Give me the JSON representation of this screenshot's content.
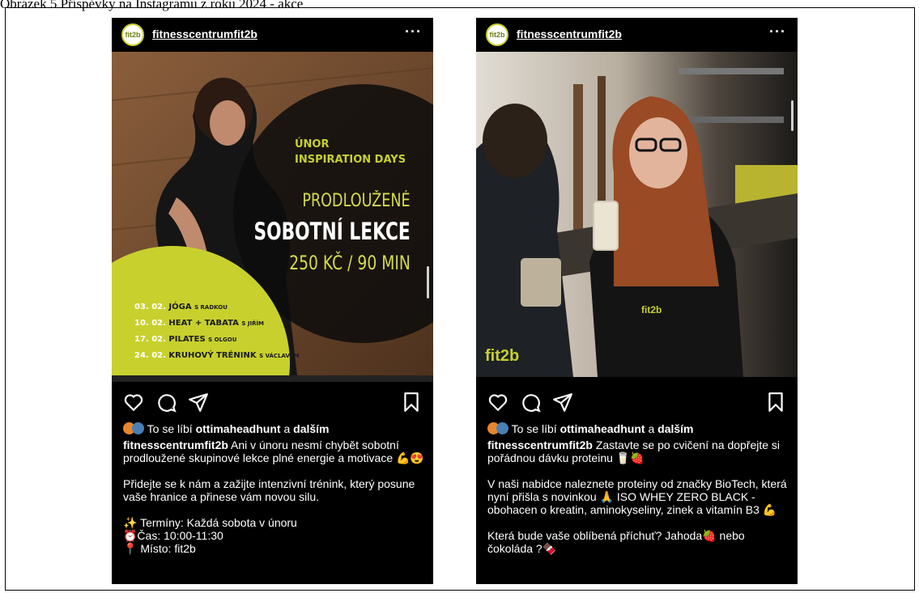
{
  "figure_caption": "Obrázek 5 Příspěvky na Instagramu z roku 2024 - akce",
  "posts": [
    {
      "account_name": "fitnesscentrumfit2b",
      "avatar_text": "fit2b",
      "more_symbol": "···",
      "banner": {
        "month": "ÚNOR",
        "event": "INSPIRATION DAYS",
        "line1": "PRODLOUŽENÉ",
        "line2": "SOBOTNÍ LEKCE",
        "price": "250 KČ / 90 MIN",
        "schedule": [
          {
            "date": "03. 02.",
            "name": "JÓGA",
            "with": "S RADKOU"
          },
          {
            "date": "10. 02.",
            "name": "HEAT + TABATA",
            "with": "S JIŘÍM"
          },
          {
            "date": "17. 02.",
            "name": "PILATES",
            "with": "S OLGOU"
          },
          {
            "date": "24. 02.",
            "name": "KRUHOVÝ TRÉNINK",
            "with": "S VÁCLAVEM"
          }
        ],
        "scroll_indicator_position": 0.7
      },
      "likes_prefix": "To se líbí",
      "likes_user": "ottimaheadhunt",
      "likes_and": "a",
      "likes_others": "dalším",
      "caption_text": "Ani v únoru nesmí chybět sobotní prodloužené skupinové lekce plné energie a motivace 💪😍",
      "para2": "Přidejte se k nám a zažijte intenzivní trénink, který posune vaše hranice a přinese vám novou silu.",
      "info1": "✨ Termíny: Každá sobota v únoru",
      "info2": "⏰Čas: 10:00-11:30",
      "info3": "📍 Místo: fit2b"
    },
    {
      "account_name": "fitnesscentrumfit2b",
      "avatar_text": "fit2b",
      "more_symbol": "···",
      "photo_logo": "fit2b",
      "shirt_logo": "fit2b",
      "likes_prefix": "To se líbí",
      "likes_user": "ottimaheadhunt",
      "likes_and": "a",
      "likes_others": "dalším",
      "caption_text": "Zastavte se po cvičení na dopřejte si pořádnou dávku proteinu 🥛🍓",
      "para2": "V naši nabidce naleznete proteiny od značky BioTech, která nyní přišla s novinkou 🙏 ISO WHEY ZERO BLACK - obohacen o kreatin, aminokyseliny, zinek a vitamín B3 💪",
      "para3": "Která bude vaše oblíbená příchuť? Jahoda🍓 nebo čokoláda ?🍫"
    }
  ],
  "colors": {
    "accent_green": "#c8d02e",
    "background": "#000000"
  },
  "icons": [
    "heart-icon",
    "comment-icon",
    "share-icon",
    "bookmark-icon"
  ]
}
